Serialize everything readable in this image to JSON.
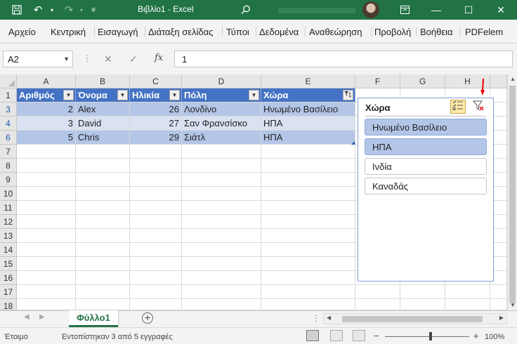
{
  "titlebar": {
    "title": "Βιβλίο1  -  Excel",
    "controls": {
      "minimize": "—",
      "maximize": "☐",
      "close": "✕"
    }
  },
  "ribbon": {
    "tabs": [
      "Αρχείο",
      "Κεντρική",
      "Εισαγωγή",
      "Διάταξη σελίδας",
      "Τύποι",
      "Δεδομένα",
      "Αναθεώρηση",
      "Προβολή",
      "Βοήθεια",
      "PDFelem"
    ]
  },
  "formula_bar": {
    "name_box": "A2",
    "fx": "fx",
    "value": "1"
  },
  "sheet": {
    "columns": [
      "A",
      "B",
      "C",
      "D",
      "E",
      "F",
      "G",
      "H"
    ],
    "rows": [
      "1",
      "3",
      "4",
      "6",
      "7",
      "8",
      "9",
      "10",
      "11",
      "12",
      "13",
      "14",
      "15",
      "16",
      "17",
      "18"
    ],
    "headers": [
      "Αριθμός",
      "Όνομα",
      "Ηλικία",
      "Πόλη",
      "Χώρα"
    ],
    "data": [
      [
        "2",
        "Alex",
        "26",
        "Λονδίνο",
        "Ηνωμένο Βασίλειο"
      ],
      [
        "3",
        "David",
        "27",
        "Σαν Φρανσίσκο",
        "ΗΠΑ"
      ],
      [
        "5",
        "Chris",
        "29",
        "Σιάτλ",
        "ΗΠΑ"
      ]
    ],
    "table_header_color": "#4472c4",
    "band_colors": [
      "#b4c6e7",
      "#d9e1f2"
    ]
  },
  "slicer": {
    "title": "Χώρα",
    "items": [
      {
        "label": "Ηνωμένο Βασίλειο",
        "selected": true
      },
      {
        "label": "ΗΠΑ",
        "selected": true
      },
      {
        "label": "Ινδία",
        "selected": false
      },
      {
        "label": "Καναδάς",
        "selected": false
      }
    ]
  },
  "tabs": {
    "sheet_name": "Φύλλο1",
    "add_label": "+"
  },
  "status": {
    "ready": "Έτοιμο",
    "filter_info": "Εντοπίστηκαν 3 από 5 εγγραφές",
    "zoom_minus": "−",
    "zoom_plus": "+",
    "zoom": "100%"
  },
  "accent": "#217346"
}
